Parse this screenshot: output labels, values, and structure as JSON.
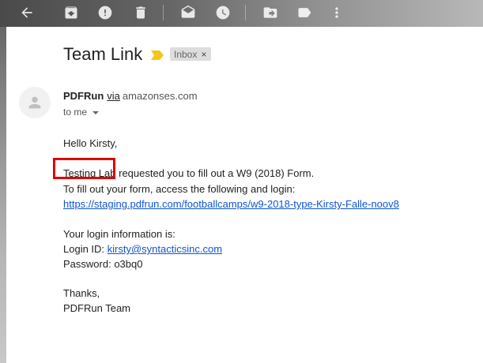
{
  "email": {
    "subject": "Team Link",
    "label_badge": "Inbox",
    "label_remove": "×",
    "sender_name": "PDFRun",
    "sender_via": "via",
    "sender_domain": "amazonses.com",
    "recipient": "to me",
    "greeting": "Hello Kirsty,",
    "line1_highlight": "Testing Lab",
    "line1_rest": " requested you to fill out a W9 (2018) Form.",
    "line2": "To fill out your form, access the following and login:",
    "form_link": "https://staging.pdfrun.com/footballcamps/w9-2018-type-Kirsty-Falle-noov8",
    "login_heading": "Your login information is:",
    "login_id_label": "Login ID: ",
    "login_id_value": "kirsty@syntacticsinc.com",
    "password_label": "Password: ",
    "password_value": "o3bq0",
    "closing": "Thanks,",
    "signature": "PDFRun Team"
  },
  "toolbar": {
    "icons": [
      "back-arrow-icon",
      "archive-icon",
      "report-spam-icon",
      "delete-icon",
      "mark-unread-icon",
      "snooze-icon",
      "move-to-icon",
      "label-icon",
      "more-vert-icon"
    ]
  },
  "colors": {
    "link": "#1155cc",
    "highlight_box": "#e00000",
    "importance_marker": "#f5c518"
  }
}
